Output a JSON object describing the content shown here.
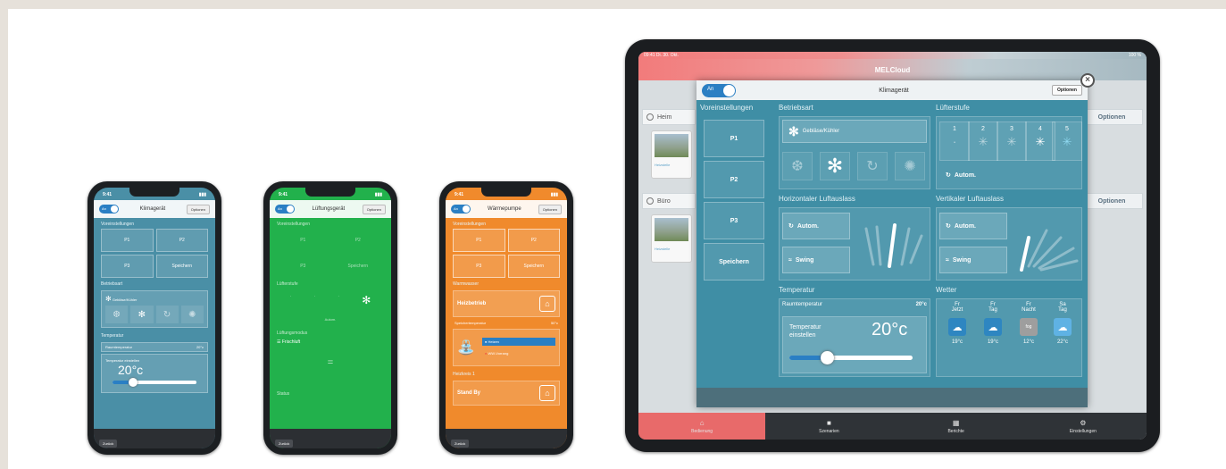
{
  "phones": [
    {
      "title": "Klimagerät",
      "status_time": "9:41",
      "toggle": "An",
      "options": "Optionen",
      "presets_label": "Voreinstellungen",
      "presets": [
        "P1",
        "P2",
        "P3",
        "Speichern"
      ],
      "mode_label": "Betriebsart",
      "mode_selected": "Gebläse/Kühler",
      "temp_label": "Temperatur",
      "room_temp_label": "Raumtemperatur",
      "room_temp_value": "20°c",
      "set_temp_label": "Temperatur einstellen",
      "set_temp_value": "20°c",
      "back": "Zurück"
    },
    {
      "title": "Lüftungsgerät",
      "status_time": "9:41",
      "toggle": "An",
      "options": "Optionen",
      "presets_label": "Voreinstellungen",
      "presets": [
        "P1",
        "P2",
        "P3",
        "Speichern"
      ],
      "fan_label": "Lüfterstufe",
      "fan_auto": "Autom.",
      "vent_label": "Lüftungsmodus",
      "vent_value": "Frischluft",
      "state_label": "Status",
      "back": "Zurück"
    },
    {
      "title": "Wärmepumpe",
      "status_time": "9:41",
      "toggle": "An",
      "options": "Optionen",
      "presets_label": "Voreinstellungen",
      "presets": [
        "P1",
        "P2",
        "P3",
        "Speichern"
      ],
      "water_label": "Warmwasser",
      "heat_mode": "Heizbetrieb",
      "tank_temp_label": "Speichertemperatur",
      "tank_temp_value": "50°c",
      "opt1": "Heizen",
      "opt2": "WW-Vorrang",
      "circuit_label": "Heizkreis 1",
      "standby": "Stand By",
      "back": "Zurück"
    }
  ],
  "tablet": {
    "status_left": "09:41 Di. 30. Okt.",
    "status_right": "100 %",
    "app_title": "MELCloud",
    "bg_home": "Heim",
    "bg_office": "Büro",
    "bg_link": "Heizstelle",
    "bg_options": "Optionen",
    "modal": {
      "toggle": "An",
      "title": "Klimagerät",
      "options": "Optionen",
      "close": "×",
      "presets_label": "Voreinstellungen",
      "presets": [
        "P1",
        "P2",
        "P3",
        "Speichern"
      ],
      "mode_label": "Betriebsart",
      "mode_selected": "Gebläse/Kühler",
      "fan_label": "Lüfterstufe",
      "fan_levels": [
        "1",
        "2",
        "3",
        "4",
        "5"
      ],
      "fan_auto": "Autom.",
      "h_vane_label": "Horizontaler Luftauslass",
      "v_vane_label": "Vertikaler Luftauslass",
      "auto": "Autom.",
      "swing": "Swing",
      "temp_label": "Temperatur",
      "room_temp_label": "Raumtemperatur",
      "room_temp_value": "20°c",
      "set_temp_label": "Temperatur einstellen",
      "set_temp_value": "20°c",
      "weather_label": "Wetter",
      "weather": [
        {
          "day": "Fr",
          "part": "Jetzt",
          "temp": "19°c",
          "icon": "sun-cloud-icon"
        },
        {
          "day": "Fr",
          "part": "Tag",
          "temp": "19°c",
          "icon": "sun-cloud-icon"
        },
        {
          "day": "Fr",
          "part": "Nacht",
          "temp": "12°c",
          "icon": "fog-icon",
          "icon_text": "fog"
        },
        {
          "day": "Sa",
          "part": "Tag",
          "temp": "22°c",
          "icon": "cloud-icon"
        }
      ]
    },
    "tabs": [
      {
        "label": "Bedienung",
        "icon": "home-icon"
      },
      {
        "label": "Szenarien",
        "icon": "camera-icon"
      },
      {
        "label": "Berichte",
        "icon": "grid-icon"
      },
      {
        "label": "Einstellungen",
        "icon": "gear-icon"
      }
    ],
    "colors": {
      "accent": "#2b7fc3",
      "panel": "#3f8ea5",
      "active_tab": "#e86a6a"
    }
  }
}
